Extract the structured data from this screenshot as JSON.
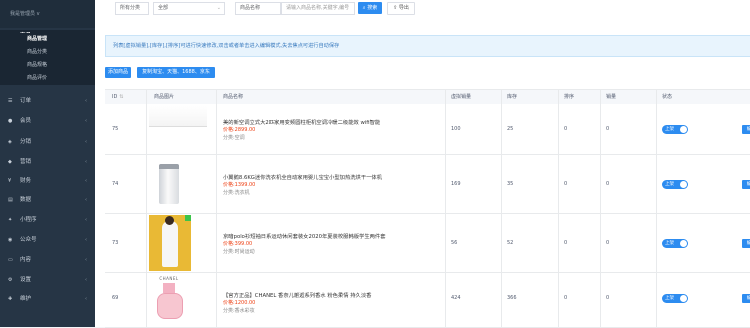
{
  "sidebar": {
    "top_text": "我是管理员 v",
    "group": {
      "label": "商品",
      "icon": "grid-icon"
    },
    "subitems": [
      {
        "label": "商品管理",
        "current": true
      },
      {
        "label": "商品分类",
        "current": false
      },
      {
        "label": "商品规格",
        "current": false
      },
      {
        "label": "商品评价",
        "current": false
      }
    ],
    "items": [
      {
        "label": "订单",
        "icon": "order-icon"
      },
      {
        "label": "会员",
        "icon": "user-icon"
      },
      {
        "label": "分销",
        "icon": "share-icon"
      },
      {
        "label": "营销",
        "icon": "gift-icon"
      },
      {
        "label": "财务",
        "icon": "money-icon"
      },
      {
        "label": "数据",
        "icon": "chart-icon"
      },
      {
        "label": "小程序",
        "icon": "app-icon"
      },
      {
        "label": "公众号",
        "icon": "wechat-icon"
      },
      {
        "label": "内容",
        "icon": "doc-icon"
      },
      {
        "label": "设置",
        "icon": "gear-icon"
      },
      {
        "label": "维护",
        "icon": "tool-icon"
      }
    ]
  },
  "toolbar": {
    "category_select": "所有分类",
    "status_select": "全部",
    "field_select": "商品名称",
    "search_placeholder": "请输入商品名称,关键字,编号",
    "search_label": "搜索",
    "export_label": "导出"
  },
  "tip": "列表[虚拟销量],[库存],[排序]可进行快速修改,双击或者单击进入编辑模式,失去焦点可进行自动保存",
  "actions": {
    "add_label": "添加商品",
    "copy_label": "复制淘宝、天猫、1688、京东"
  },
  "table": {
    "headers": [
      "ID",
      "商品图片",
      "商品名称",
      "虚拟销量",
      "库存",
      "排序",
      "销量",
      "状态"
    ],
    "rows": [
      {
        "id": "75",
        "name": "美的新空调立式大2匹家用变频圆柱柜机空调冷暖二级能效 wifi智能",
        "price": "价格:2899.00",
        "category": "分类:空调",
        "virtual_sales": "100",
        "stock": "25",
        "sort": "0",
        "sales": "0",
        "status": "上架",
        "image": "fridge-image"
      },
      {
        "id": "74",
        "name": "小翼鹅8.6KG迷你洗衣机全自动家用婴儿宝宝小型加热洗烘干一体机",
        "price": "价格:1399.00",
        "category": "分类:洗衣机",
        "virtual_sales": "169",
        "stock": "35",
        "sort": "0",
        "sales": "0",
        "status": "上架",
        "image": "washer-image"
      },
      {
        "id": "73",
        "name": "京暗polo衫短袖日系运动休闲套装女2020年夏装校服韩版学生两件套",
        "price": "价格:399.00",
        "category": "分类:时尚运动",
        "virtual_sales": "56",
        "stock": "52",
        "sort": "0",
        "sales": "0",
        "status": "上架",
        "image": "model-image"
      },
      {
        "id": "69",
        "name": "【官方正品】CHANEL 香奈儿邂逅系列香水 粉色柔情 持久淡香",
        "price": "价格:1200.00",
        "category": "分类:香水彩妆",
        "virtual_sales": "424",
        "stock": "366",
        "sort": "0",
        "sales": "0",
        "status": "上架",
        "image": "perfume-image",
        "brand_text": "CHANEL"
      }
    ],
    "edit_label": "编"
  }
}
